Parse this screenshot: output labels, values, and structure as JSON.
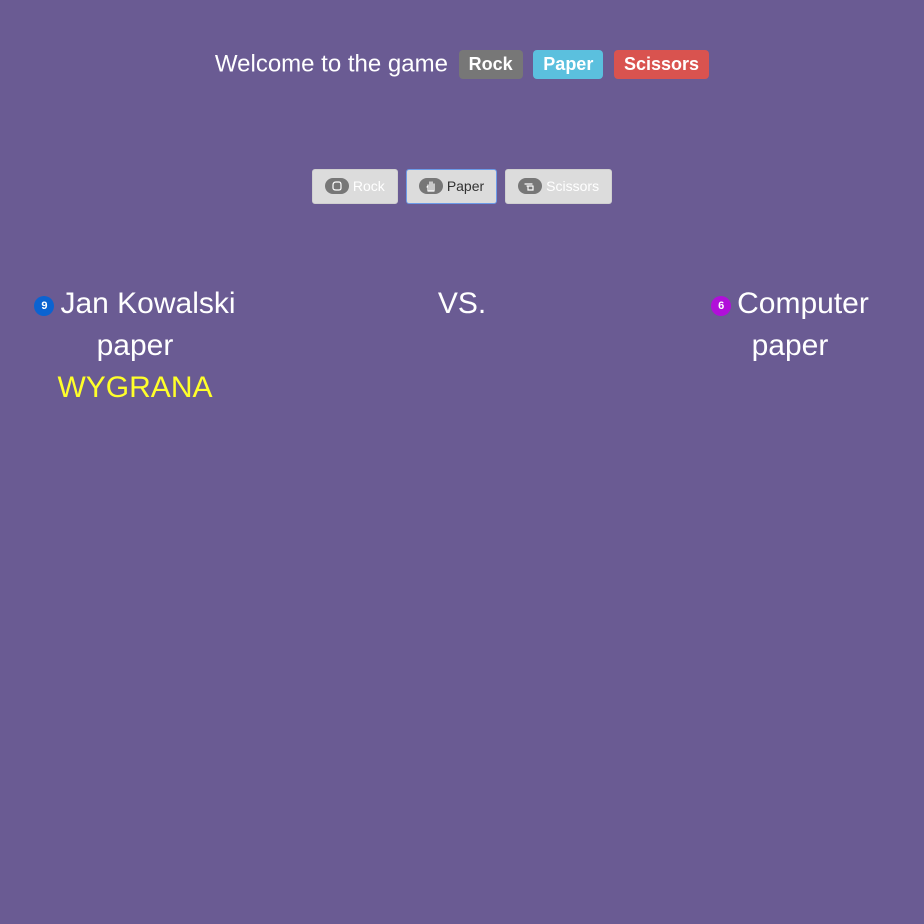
{
  "header": {
    "title": "Welcome to the game",
    "labels": [
      "Rock",
      "Paper",
      "Scissors"
    ]
  },
  "choices": [
    {
      "label": "Rock",
      "icon": "rock-hand-icon",
      "active": false
    },
    {
      "label": "Paper",
      "icon": "paper-hand-icon",
      "active": true
    },
    {
      "label": "Scissors",
      "icon": "scissors-hand-icon",
      "active": false
    }
  ],
  "player": {
    "score": "9",
    "name": "Jan Kowalski",
    "choice": "paper",
    "result": "WYGRANA"
  },
  "vs_label": "VS.",
  "computer": {
    "score": "6",
    "name": "Computer",
    "choice": "paper"
  },
  "colors": {
    "background": "#6a5b93",
    "rock": "#777777",
    "paper": "#5bc0de",
    "scissors": "#d9534f",
    "result": "#ffff2a",
    "player_badge": "#0b63d1",
    "computer_badge": "#b10fd9"
  }
}
